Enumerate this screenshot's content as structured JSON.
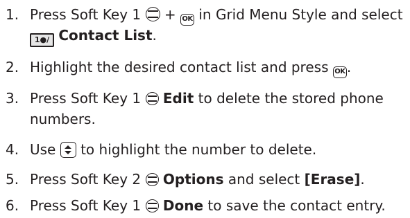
{
  "steps": [
    {
      "num": "1.",
      "t1": "Press Soft Key 1",
      "plus": "+",
      "t2": "in Grid Menu Style and select",
      "line2_key": "1●/",
      "line2_bold": "Contact List",
      "line2_tail": "."
    },
    {
      "num": "2.",
      "t1": "Highlight the desired contact list and press",
      "tail": "."
    },
    {
      "num": "3.",
      "t1": "Press Soft Key 1",
      "bold": "Edit",
      "t2": "to delete the stored phone",
      "line2": "numbers."
    },
    {
      "num": "4.",
      "t1": "Use",
      "t2": "to highlight the number to delete."
    },
    {
      "num": "5.",
      "t1": "Press Soft Key 2",
      "bold": "Options",
      "t2": "and select",
      "bold2": "[Erase]",
      "tail": "."
    },
    {
      "num": "6.",
      "t1": "Press Soft Key 1",
      "bold": "Done",
      "t2": "to save the contact entry."
    }
  ],
  "icons": {
    "ok_label": "OK"
  }
}
